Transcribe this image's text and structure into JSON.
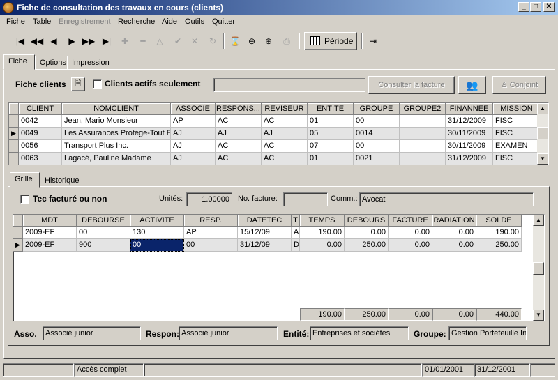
{
  "window": {
    "title": "Fiche de consultation des travaux en cours (clients)"
  },
  "menu": [
    "Fiche",
    "Table",
    "Enregistrement",
    "Recherche",
    "Aide",
    "Outils",
    "Quitter"
  ],
  "toolbar": {
    "periode_label": "Période"
  },
  "tabs": {
    "fiche": "Fiche",
    "options": "Options",
    "impression": "Impression"
  },
  "fiche": {
    "label": "Fiche clients",
    "actifs_label": "Clients actifs seulement",
    "search_value": "",
    "consulter_label": "Consulter la facture",
    "conjoint_label": "Conjoint"
  },
  "clients": {
    "columns": [
      "CLIENT",
      "NOMCLIENT",
      "ASSOCIE",
      "RESPONS...",
      "REVISEUR",
      "ENTITE",
      "GROUPE",
      "GROUPE2",
      "FINANNEE",
      "MISSION"
    ],
    "rows": [
      [
        "0042",
        "Jean, Mario Monsieur",
        "AP",
        "AC",
        "AC",
        "01",
        "00",
        "",
        "31/12/2009",
        "FISC"
      ],
      [
        "0049",
        "Les Assurances Protège-Tout Enr",
        "AJ",
        "AJ",
        "AJ",
        "05",
        "0014",
        "",
        "30/11/2009",
        "FISC"
      ],
      [
        "0056",
        "Transport Plus Inc.",
        "AJ",
        "AC",
        "AC",
        "07",
        "00",
        "",
        "30/11/2009",
        "EXAMEN"
      ],
      [
        "0063",
        "Lagacé, Pauline Madame",
        "AJ",
        "AC",
        "AC",
        "01",
        "0021",
        "",
        "31/12/2009",
        "FISC"
      ]
    ]
  },
  "subtabs": {
    "grille": "Grille",
    "historique": "Historique"
  },
  "grille": {
    "tec_label": "Tec facturé ou non",
    "unites_label": "Unités:",
    "unites_value": "1.00000",
    "nofacture_label": "No. facture:",
    "nofacture_value": "",
    "comm_label": "Comm.:",
    "comm_value": "Avocat"
  },
  "travaux": {
    "columns": [
      "MDT",
      "DEBOURSE",
      "ACTIVITE",
      "RESP.",
      "DATETEC",
      "T",
      "TEMPS",
      "DEBOURS",
      "FACTURE",
      "RADIATION",
      "SOLDE"
    ],
    "rows": [
      [
        "2009-EF",
        "00",
        "130",
        "AP",
        "15/12/09",
        "A",
        "190.00",
        "0.00",
        "0.00",
        "0.00",
        "190.00"
      ],
      [
        "2009-EF",
        "900",
        "00",
        "00",
        "31/12/09",
        "D",
        "0.00",
        "250.00",
        "0.00",
        "0.00",
        "250.00"
      ]
    ],
    "totals": [
      "190.00",
      "250.00",
      "0.00",
      "0.00",
      "440.00"
    ]
  },
  "footer": {
    "asso_label": "Asso.",
    "asso_value": "Associé junior",
    "respon_label": "Respon:",
    "respon_value": "Associé junior",
    "entite_label": "Entité:",
    "entite_value": "Entreprises et sociétés",
    "groupe_label": "Groupe:",
    "groupe_value": "Gestion Portefeuille In"
  },
  "status": {
    "access": "Accès complet",
    "date_from": "01/01/2001",
    "date_to": "31/12/2001"
  },
  "colors": {
    "titlebar": "#0a246a",
    "selection": "#0a246a",
    "face": "#d4d0c8"
  }
}
